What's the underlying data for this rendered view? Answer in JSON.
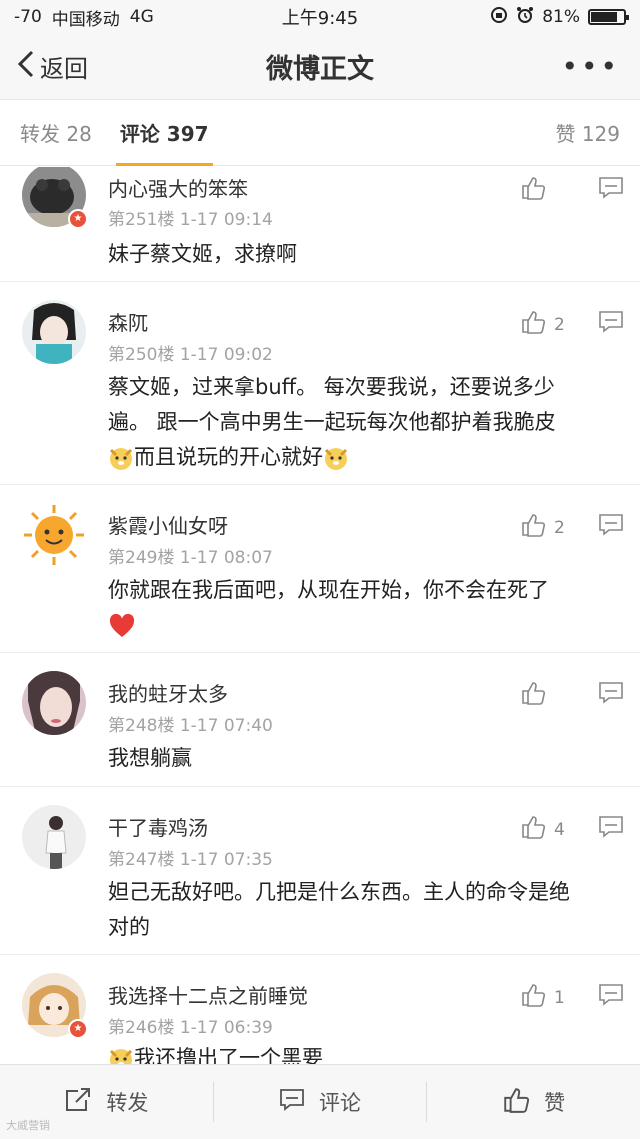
{
  "status": {
    "signal": "-70",
    "carrier": "中国移动",
    "network": "4G",
    "time": "上午9:45",
    "battery_text": "81%",
    "battery_level": 0.81
  },
  "nav": {
    "back_label": "返回",
    "title": "微博正文"
  },
  "tabs": {
    "repost": "转发 28",
    "comments": "评论 397",
    "likes": "赞 129"
  },
  "comments": [
    {
      "user": "内心强大的笨笨",
      "meta": "第251楼 1-17 09:14",
      "likes": "",
      "text": "妹子蔡文姬，求撩啊",
      "verified": true
    },
    {
      "user": "森阢",
      "meta": "第250楼 1-17 09:02",
      "likes": "2",
      "text_line1": "蔡文姬，过来拿buff。 每次要我说，还要说多少",
      "text_line2": "遍。 跟一个高中男生一起玩每次他都护着我脆皮",
      "text_line3": "而且说玩的开心就好",
      "verified": false
    },
    {
      "user": "紫霞小仙女呀",
      "meta": "第249楼 1-17 08:07",
      "likes": "2",
      "text": "你就跟在我后面吧，从现在开始，你不会在死了",
      "verified": false
    },
    {
      "user": "我的蛀牙太多",
      "meta": "第248楼 1-17 07:40",
      "likes": "",
      "text": "我想躺赢",
      "verified": false
    },
    {
      "user": "干了毒鸡汤",
      "meta": "第247楼 1-17 07:35",
      "likes": "4",
      "text_line1": "妲己无敌好吧。几把是什么东西。主人的命令是绝",
      "text_line2": "对的",
      "verified": false
    },
    {
      "user": "我选择十二点之前睡觉",
      "meta": "第246楼 1-17 06:39",
      "likes": "1",
      "text": "我还撸出了一个黑要",
      "verified": true
    }
  ],
  "bottom": {
    "repost": "转发",
    "comment": "评论",
    "like": "赞"
  },
  "watermark": "大威营销",
  "colors": {
    "accent": "#f5a623",
    "verified_badge": "#e8513a",
    "heart": "#e83b35"
  },
  "icons": [
    "back-chevron-icon",
    "more-dots-icon",
    "thumb-up-icon",
    "reply-bubble-icon",
    "dog-emoji-icon",
    "heart-emoji-icon",
    "share-icon",
    "comment-icon"
  ]
}
